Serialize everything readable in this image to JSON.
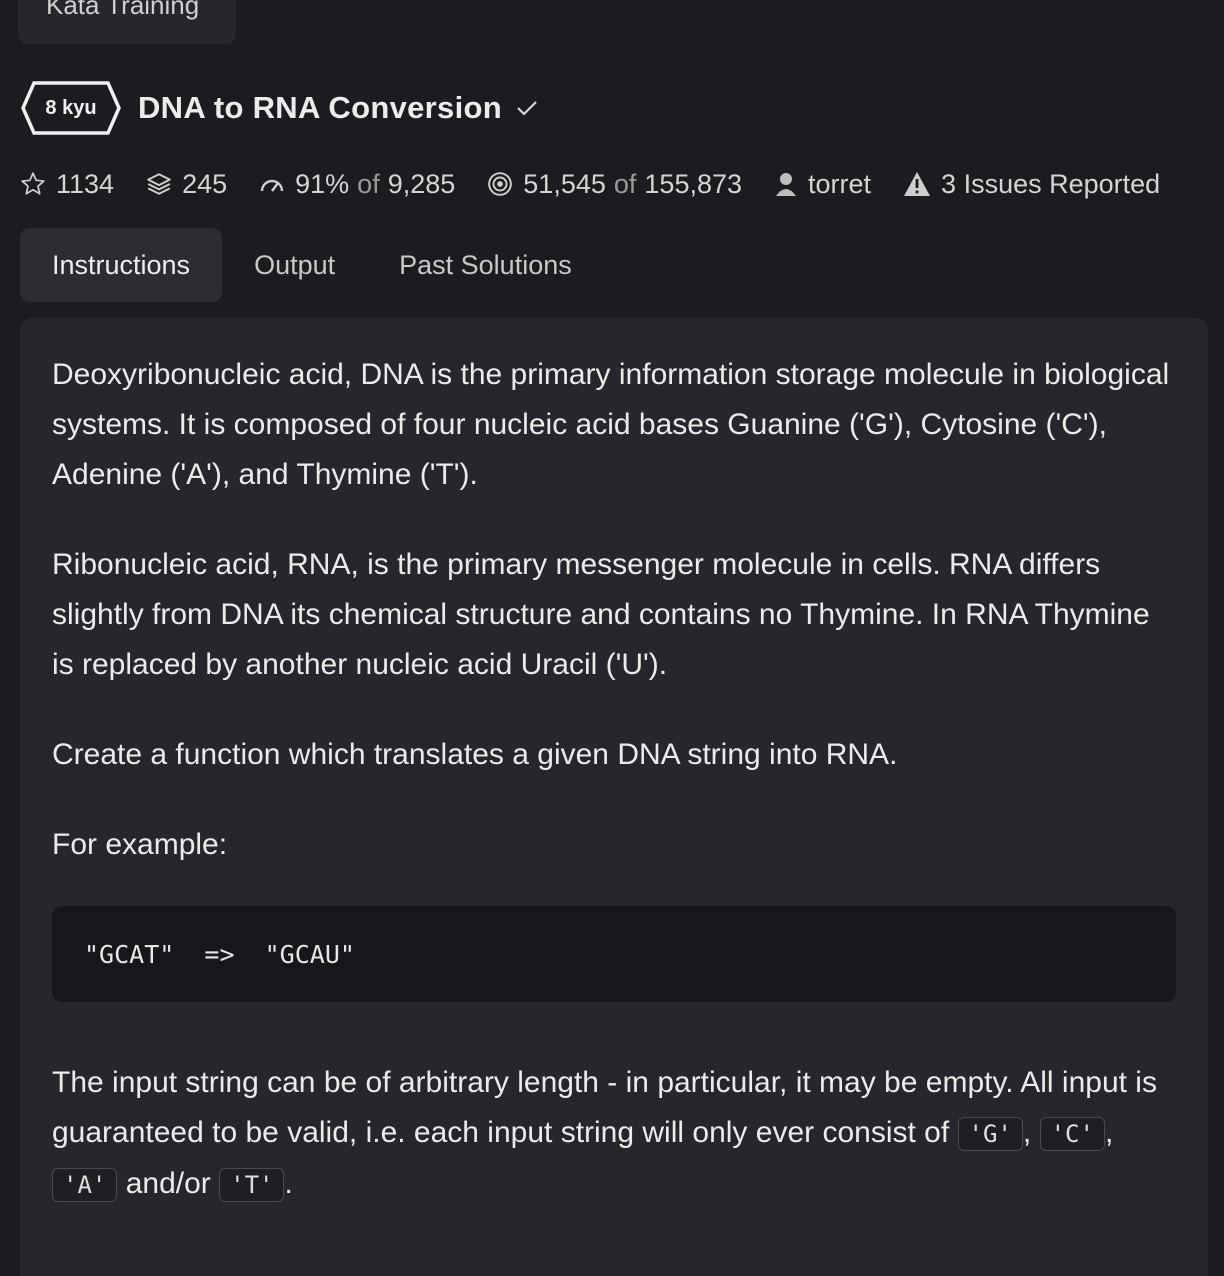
{
  "top_button": {
    "label": "Kata Training"
  },
  "kata": {
    "rank": "8 kyu",
    "title": "DNA to RNA Conversion"
  },
  "stats": {
    "stars": "1134",
    "collections": "245",
    "satisfaction_pct": "91%",
    "of_label": "of",
    "satisfaction_votes": "9,285",
    "completed": "51,545",
    "attempted": "155,873",
    "author": "torret",
    "issues": "3 Issues Reported"
  },
  "tabs": [
    {
      "label": "Instructions",
      "active": true
    },
    {
      "label": "Output",
      "active": false
    },
    {
      "label": "Past Solutions",
      "active": false
    }
  ],
  "instructions": {
    "p1": "Deoxyribonucleic acid, DNA is the primary information storage molecule in biological systems. It is composed of four nucleic acid bases Guanine ('G'), Cytosine ('C'), Adenine ('A'), and Thymine ('T').",
    "p2": "Ribonucleic acid, RNA, is the primary messenger molecule in cells. RNA differs slightly from DNA its chemical structure and contains no Thymine. In RNA Thymine is replaced by another nucleic acid Uracil ('U').",
    "p3": "Create a function which translates a given DNA string into RNA.",
    "p4": "For example:",
    "code": "\"GCAT\"  =>  \"GCAU\"",
    "p5_text": "The input string can be of arbitrary length - in particular, it may be empty. All input is guaranteed to be valid, i.e. each input string will only ever consist of",
    "code_g": "'G'",
    "sep1": ",",
    "code_c": "'C'",
    "sep2": ",",
    "code_a": "'A'",
    "and_or": "and/or",
    "code_t": "'T'",
    "end": "."
  },
  "colors": {
    "background": "#1b1c20",
    "panel": "#26272c",
    "code_bg": "#16171a",
    "tab_active": "#2c2d32"
  }
}
